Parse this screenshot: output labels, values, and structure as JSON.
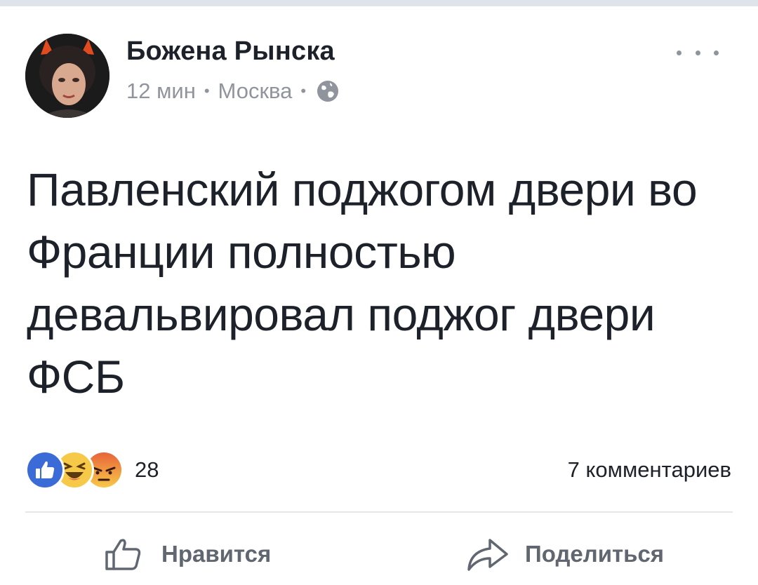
{
  "post": {
    "author": "Божена Рынска",
    "time": "12 мин",
    "location": "Москва",
    "separator": "•",
    "text": "Павленский поджогом двери во Франции полностью девальвировал поджог двери ФСБ"
  },
  "reactions": {
    "icons": [
      "like-icon",
      "haha-icon",
      "angry-icon"
    ],
    "count": "28"
  },
  "comments": {
    "label": "7 комментариев"
  },
  "actions": {
    "like_label": "Нравится",
    "share_label": "Поделиться"
  },
  "colors": {
    "like_blue": "#3b6bd6",
    "haha_yellow": "#f7c948",
    "angry_orange": "#e8643a",
    "meta_gray": "#90949c",
    "action_gray": "#606770"
  }
}
